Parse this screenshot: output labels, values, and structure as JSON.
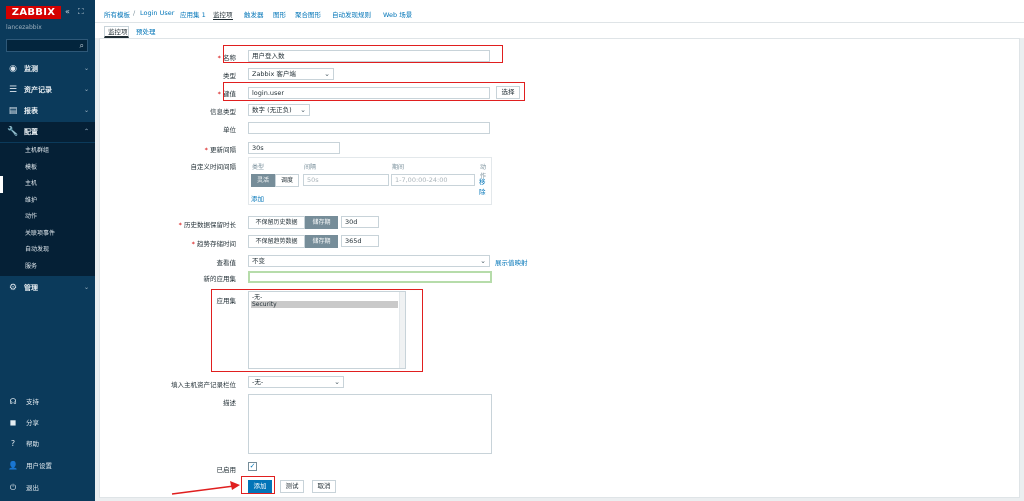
{
  "sidebar": {
    "logo": "ZABBIX",
    "collapse_icon": "«",
    "kiosk_icon": "⛶",
    "hostname": "lancezabbix",
    "search_placeholder": "",
    "menu": [
      {
        "label": "监测",
        "icon": "eye-icon"
      },
      {
        "label": "资产记录",
        "icon": "list-icon"
      },
      {
        "label": "报表",
        "icon": "report-icon"
      },
      {
        "label": "配置",
        "icon": "wrench-icon"
      },
      {
        "label": "管理",
        "icon": "gear-icon"
      }
    ],
    "submenu": [
      "主机群组",
      "模板",
      "主机",
      "维护",
      "动作",
      "关联项事件",
      "自动发现",
      "服务"
    ],
    "bottom": [
      "支持",
      "分享",
      "帮助",
      "用户设置",
      "退出"
    ]
  },
  "breadcrumb": {
    "all_templates": "所有模板",
    "slash": "/",
    "template": "Login User",
    "applications": "应用集 1",
    "items": "监控项",
    "triggers": "触发器",
    "graphs": "图形",
    "screens": "聚合图形",
    "discovery": "自动发现规则",
    "web": "Web 场景"
  },
  "tabs": {
    "item": "监控项",
    "preprocessing": "预处理"
  },
  "form": {
    "name_label": "名称",
    "name_value": "用户登入数",
    "type_label": "类型",
    "type_value": "Zabbix 客户端",
    "key_label": "键值",
    "key_value": "login.user",
    "select_button": "选择",
    "info_type_label": "信息类型",
    "info_type_value": "数字 (无正负)",
    "units_label": "单位",
    "units_value": "",
    "interval_label": "更新间隔",
    "interval_value": "30s",
    "custom_label": "自定义时间间隔",
    "custom_headers": {
      "type": "类型",
      "interval": "间隔",
      "period": "期间",
      "action": "动作"
    },
    "custom_seg_flexible": "灵活",
    "custom_seg_scheduling": "调度",
    "custom_interval_placeholder": "50s",
    "custom_period_placeholder": "1-7,00:00-24:00",
    "remove_link": "移除",
    "add_link": "添加",
    "history_label": "历史数据保留时长",
    "history_seg_off": "不保留历史数据",
    "history_seg_on": "储存期",
    "history_value": "30d",
    "trend_label": "趋势存储时间",
    "trend_seg_off": "不保留趋势数据",
    "trend_seg_on": "储存期",
    "trend_value": "365d",
    "valuemap_label": "查看值",
    "valuemap_value": "不变",
    "valuemap_link": "展示值映射",
    "new_app_label": "新的应用集",
    "new_app_value": "",
    "apps_label": "应用集",
    "apps_options": [
      "-无-",
      "Security"
    ],
    "inventory_label": "填入主机资产记录栏位",
    "inventory_value": "-无-",
    "description_label": "描述",
    "enabled_label": "已启用",
    "add_button": "添加",
    "test_button": "测试",
    "cancel_button": "取消"
  },
  "colors": {
    "sidebar": "#0b3a5b",
    "accent": "#0275b8",
    "annotation": "#e01f1f"
  }
}
